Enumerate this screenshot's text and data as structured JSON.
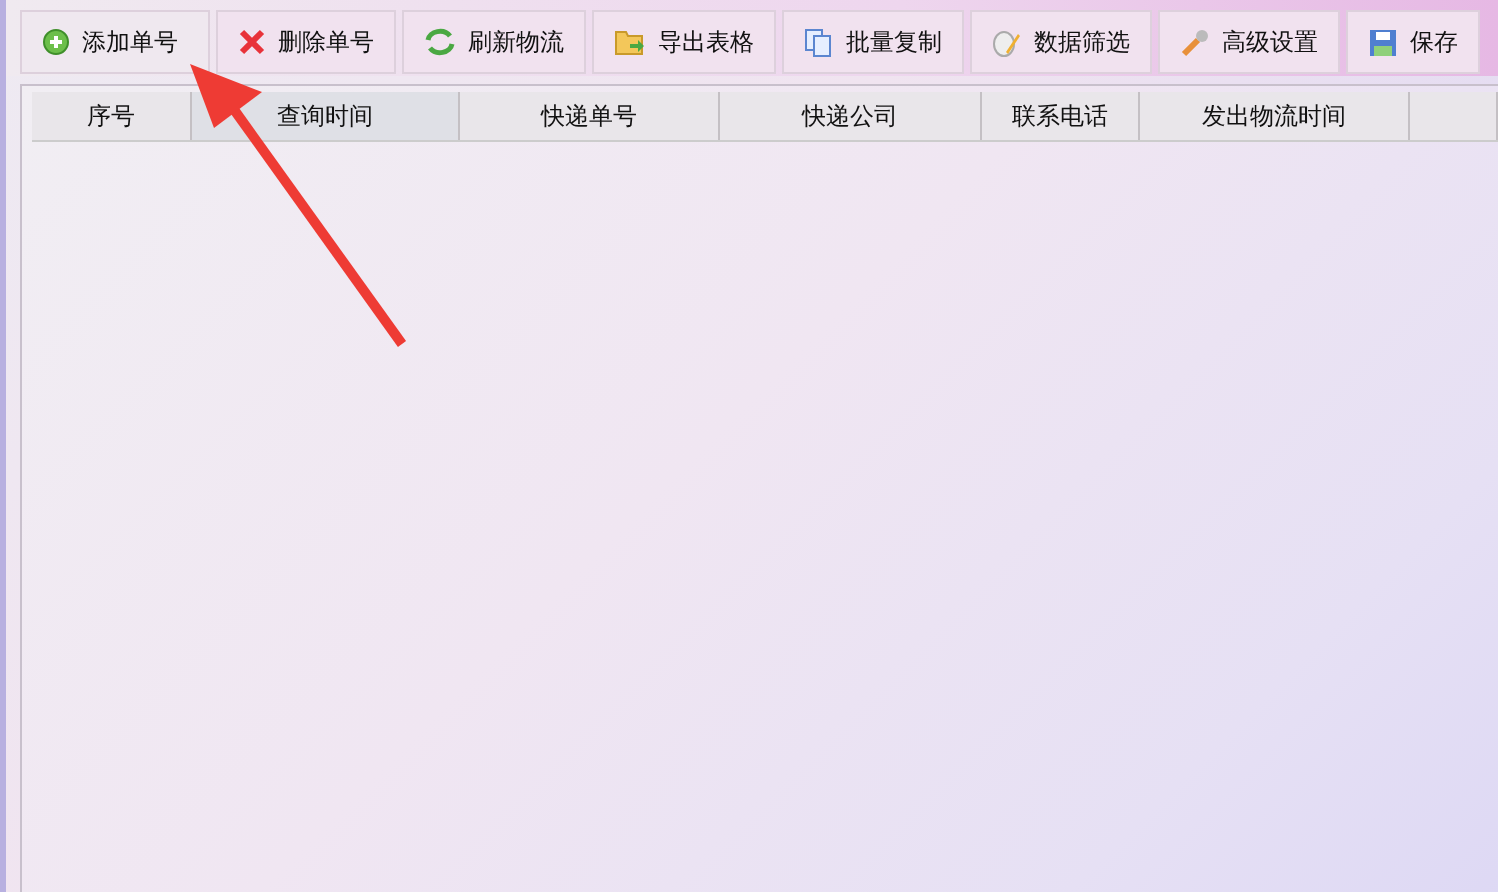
{
  "toolbar": [
    {
      "label": "添加单号",
      "kind": "add"
    },
    {
      "label": "删除单号",
      "kind": "delete"
    },
    {
      "label": "刷新物流",
      "kind": "refresh"
    },
    {
      "label": "导出表格",
      "kind": "export"
    },
    {
      "label": "批量复制",
      "kind": "copy"
    },
    {
      "label": "数据筛选",
      "kind": "filter"
    },
    {
      "label": "高级设置",
      "kind": "settings"
    },
    {
      "label": "保存",
      "kind": "save"
    }
  ],
  "table": {
    "columns": [
      "序号",
      "查询时间",
      "快递单号",
      "快递公司",
      "联系电话",
      "发出物流时间"
    ]
  }
}
